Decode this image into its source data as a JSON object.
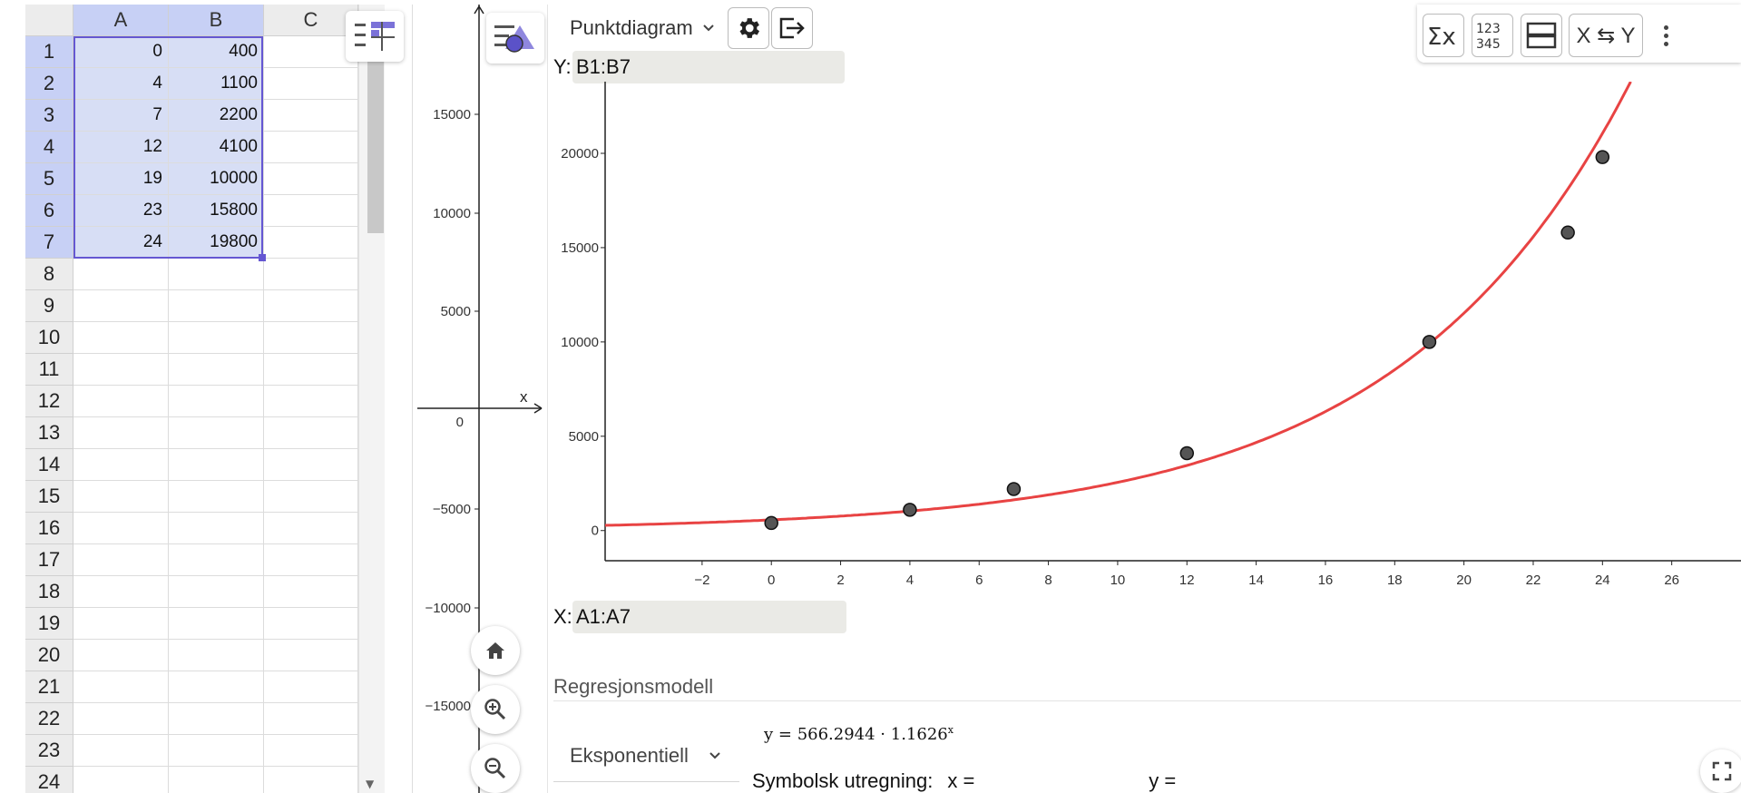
{
  "spreadsheet": {
    "columns": [
      "A",
      "B",
      "C"
    ],
    "row_numbers": [
      "1",
      "2",
      "3",
      "4",
      "5",
      "6",
      "7",
      "8",
      "9",
      "10",
      "11",
      "12",
      "13",
      "14",
      "15",
      "16",
      "17",
      "18",
      "19",
      "20",
      "21",
      "22",
      "23",
      "24"
    ],
    "selected_rows": 7,
    "data": [
      {
        "a": "0",
        "b": "400"
      },
      {
        "a": "4",
        "b": "1100"
      },
      {
        "a": "7",
        "b": "2200"
      },
      {
        "a": "12",
        "b": "4100"
      },
      {
        "a": "19",
        "b": "10000"
      },
      {
        "a": "23",
        "b": "15800"
      },
      {
        "a": "24",
        "b": "19800"
      }
    ]
  },
  "graphics": {
    "y_ticks": [
      "15000",
      "10000",
      "5000",
      "0",
      "−5000",
      "−10000",
      "−15000"
    ],
    "x_axis_label": "x"
  },
  "analysis": {
    "plot_type": "Punktdiagram",
    "y_label": "Y:",
    "y_source": "B1:B7",
    "x_label": "X:",
    "x_source": "A1:A7",
    "right_tools": {
      "swap_label": "X ⇆ Y"
    },
    "regression": {
      "title": "Regresjonsmodell",
      "model": "Eksponentiell",
      "formula": "y = 566.2944 · 1.1626",
      "formula_exp": "x",
      "symbolic_label": "Symbolsk utregning:",
      "x_eq": "x =",
      "y_eq": "y ="
    },
    "colors": {
      "curve": "#e84343",
      "points": "#555555",
      "selection": "#6557d2"
    }
  },
  "chart_data": {
    "type": "scatter",
    "x": [
      0,
      4,
      7,
      12,
      19,
      23,
      24
    ],
    "y": [
      400,
      1100,
      2200,
      4100,
      10000,
      15800,
      19800
    ],
    "x_ticks": [
      "−2",
      "0",
      "2",
      "4",
      "6",
      "8",
      "10",
      "12",
      "14",
      "16",
      "18",
      "20",
      "22",
      "24",
      "26"
    ],
    "y_ticks": [
      "0",
      "5000",
      "10000",
      "15000",
      "20000"
    ],
    "xlim": [
      -4.8,
      28
    ],
    "ylim": [
      -1600,
      23800
    ],
    "fit": {
      "a": 566.2944,
      "b": 1.1626
    }
  }
}
